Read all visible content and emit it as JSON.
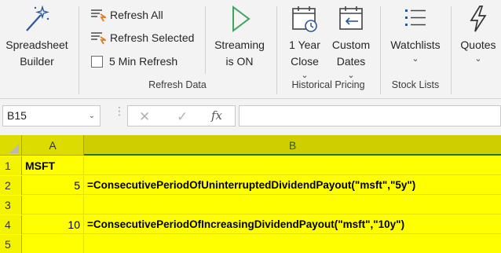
{
  "ribbon": {
    "spreadsheet_builder": [
      "Spreadsheet",
      "Builder"
    ],
    "refresh_all": "Refresh All",
    "refresh_selected": "Refresh Selected",
    "five_min_refresh": "5 Min Refresh",
    "five_min_refresh_checked": false,
    "streaming": [
      "Streaming",
      "is ON"
    ],
    "refresh_group_label": "Refresh Data",
    "one_year_close": [
      "1 Year",
      "Close"
    ],
    "custom_dates": [
      "Custom",
      "Dates"
    ],
    "historical_group_label": "Historical Pricing",
    "watchlists": "Watchlists",
    "stock_lists_group_label": "Stock Lists",
    "quotes": "Quotes",
    "dropdown_glyph": "⌄"
  },
  "formula_bar": {
    "name_box": "B15",
    "formula": "",
    "cancel_glyph": "✕",
    "enter_glyph": "✓",
    "fx_glyph": "fx"
  },
  "grid": {
    "columns": [
      "A",
      "B"
    ],
    "rows": [
      {
        "num": "1",
        "a": "MSFT",
        "b": ""
      },
      {
        "num": "2",
        "a": "5",
        "b": "=ConsecutivePeriodOfUninterruptedDividendPayout(\"msft\",\"5y\")"
      },
      {
        "num": "3",
        "a": "",
        "b": ""
      },
      {
        "num": "4",
        "a": "10",
        "b": "=ConsecutivePeriodOfIncreasingDividendPayout(\"msft\",\"10y\")"
      },
      {
        "num": "5",
        "a": "",
        "b": ""
      }
    ],
    "highlight_color": "#ffff00",
    "accent_color": "#217346"
  }
}
